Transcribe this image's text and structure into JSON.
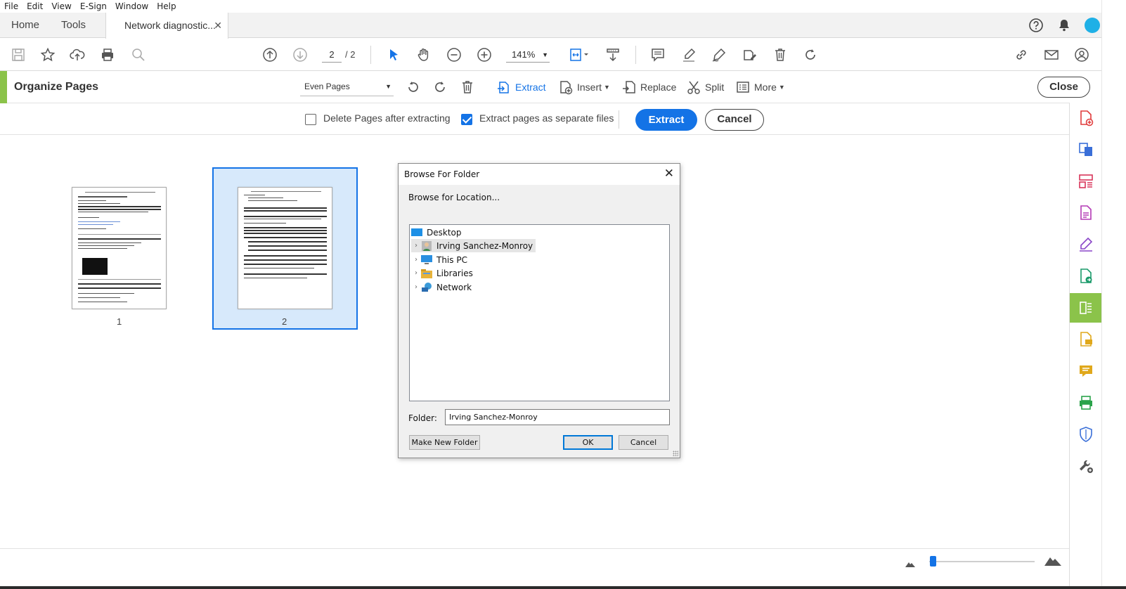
{
  "menu": [
    "File",
    "Edit",
    "View",
    "E-Sign",
    "Window",
    "Help"
  ],
  "tabs": {
    "home": "Home",
    "tools": "Tools",
    "document": "Network diagnostic...",
    "close_glyph": "✕"
  },
  "toolbar": {
    "page_current": "2",
    "page_total": "/ 2",
    "zoom": "141%",
    "caret": "▼"
  },
  "organize": {
    "title": "Organize Pages",
    "page_filter": "Even Pages",
    "extract": "Extract",
    "insert": "Insert",
    "replace": "Replace",
    "split": "Split",
    "more": "More",
    "close": "Close"
  },
  "extract_options": {
    "delete_pages_label": "Delete Pages after extracting",
    "delete_pages_checked": false,
    "separate_files_label": "Extract pages as separate files",
    "separate_files_checked": true,
    "extract_button": "Extract",
    "cancel_button": "Cancel"
  },
  "thumbnails": [
    {
      "label": "1",
      "selected": false
    },
    {
      "label": "2",
      "selected": true
    }
  ],
  "dialog": {
    "title": "Browse For Folder",
    "close_glyph": "✕",
    "subtitle": "Browse for Location...",
    "tree": [
      {
        "label": "Desktop",
        "icon": "desktop-icon",
        "expandable": false
      },
      {
        "label": "Irving Sanchez-Monroy",
        "icon": "user-folder-icon",
        "expandable": true,
        "selected": true
      },
      {
        "label": "This PC",
        "icon": "pc-icon",
        "expandable": true
      },
      {
        "label": "Libraries",
        "icon": "libraries-icon",
        "expandable": true
      },
      {
        "label": "Network",
        "icon": "network-icon",
        "expandable": true
      }
    ],
    "folder_label": "Folder:",
    "folder_value": "Irving Sanchez-Monroy",
    "make_new_folder": "Make New Folder",
    "ok": "OK",
    "cancel": "Cancel"
  },
  "colors": {
    "accent_blue": "#1473e6",
    "organize_green": "#8bc34a",
    "selection_fill": "#d7e9fb"
  }
}
